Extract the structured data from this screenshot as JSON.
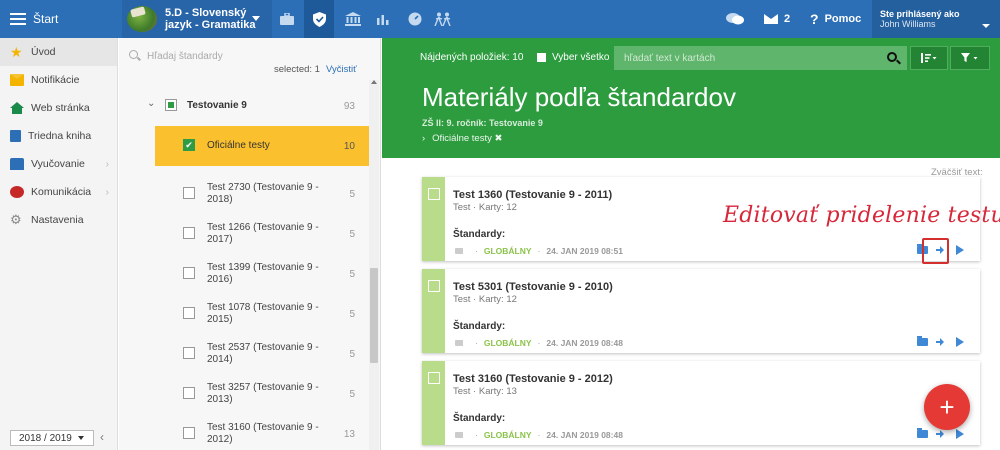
{
  "topbar": {
    "menu_label": "Štart",
    "class_name_line1": "5.D - Slovenský",
    "class_name_line2": "jazyk - Gramatika",
    "messages_count": "2",
    "help_label": "Pomoc",
    "user_line1": "Ste prihlásený ako",
    "user_line2": "John Williams",
    "icons": [
      "briefcase-icon",
      "shield-icon",
      "institution-icon",
      "bar-chart-icon",
      "gauge-icon",
      "people-icon"
    ]
  },
  "leftnav": {
    "items": [
      {
        "label": "Úvod",
        "icon": "star-icon"
      },
      {
        "label": "Notifikácie",
        "icon": "mail-icon"
      },
      {
        "label": "Web stránka",
        "icon": "home-icon"
      },
      {
        "label": "Triedna kniha",
        "icon": "book-icon"
      },
      {
        "label": "Vyučovanie",
        "icon": "school-icon"
      },
      {
        "label": "Komunikácia",
        "icon": "chat-icon"
      },
      {
        "label": "Nastavenia",
        "icon": "gear-icon"
      }
    ],
    "school_year": "2018 / 2019"
  },
  "tree": {
    "search_placeholder": "Hľadaj štandardy",
    "selected_text": "selected: 1",
    "clear_label": "Vyčistiť",
    "parent": {
      "label": "Testovanie 9",
      "count": "93"
    },
    "selected_child": {
      "label": "Oficiálne testy",
      "count": "10"
    },
    "items": [
      {
        "label": "Test 2730 (Testovanie 9 - 2018)",
        "count": "5"
      },
      {
        "label": "Test 1266 (Testovanie 9 - 2017)",
        "count": "5"
      },
      {
        "label": "Test 1399 (Testovanie 9 - 2016)",
        "count": "5"
      },
      {
        "label": "Test 1078 (Testovanie 9 - 2015)",
        "count": "5"
      },
      {
        "label": "Test 2537 (Testovanie 9 - 2014)",
        "count": "5"
      },
      {
        "label": "Test 3257 (Testovanie 9 - 2013)",
        "count": "5"
      },
      {
        "label": "Test 3160 (Testovanie 9 - 2012)",
        "count": "13"
      }
    ]
  },
  "header": {
    "found_text": "Nájdených položiek: 10",
    "select_all": "Vyber všetko",
    "search_placeholder": "hľadať text v kartách",
    "title": "Materiály podľa štandardov",
    "subtitle": "ZŠ II: 9. ročník: Testovanie 9",
    "filter_label": "Oficiálne testy ✖"
  },
  "zoom_text": "Zväčšiť text:",
  "annotation": "Editovať pridelenie testu",
  "cards": [
    {
      "title": "Test 1360 (Testovanie 9 - 2011)",
      "meta": "Test · Karty: 12",
      "standards_label": "Štandardy:",
      "scope": "GLOBÁLNY",
      "date": "24. JAN 2019 08:51"
    },
    {
      "title": "Test 5301 (Testovanie 9 - 2010)",
      "meta": "Test · Karty: 12",
      "standards_label": "Štandardy:",
      "scope": "GLOBÁLNY",
      "date": "24. JAN 2019 08:48"
    },
    {
      "title": "Test 3160 (Testovanie 9 - 2012)",
      "meta": "Test · Karty: 13",
      "standards_label": "Štandardy:",
      "scope": "GLOBÁLNY",
      "date": "24. JAN 2019 08:48"
    }
  ],
  "fab_label": "+",
  "colors": {
    "topbar": "#2c6fb7",
    "header_green": "#2d9c3f",
    "selected_yellow": "#fbc02d",
    "card_strip": "#b9dc8a",
    "fab_red": "#e53935",
    "annotation_red": "#d7273a"
  }
}
